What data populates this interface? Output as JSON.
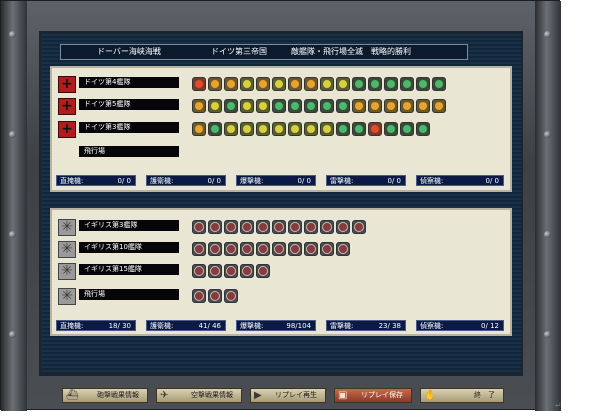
{
  "title_bar": {
    "battle": "ドーバー海峡海戦",
    "faction": "ドイツ第三帝国",
    "result": "敵艦隊・飛行場全滅　戦略的勝利"
  },
  "axis": {
    "fleets": [
      {
        "name": "ドイツ第4艦隊",
        "tokens": [
          "r",
          "o",
          "o",
          "y",
          "o",
          "y",
          "o",
          "o",
          "y",
          "y",
          "g",
          "g",
          "g",
          "g",
          "g",
          "g"
        ]
      },
      {
        "name": "ドイツ第5艦隊",
        "tokens": [
          "o",
          "y",
          "g",
          "y",
          "y",
          "g",
          "g",
          "g",
          "g",
          "g",
          "o",
          "o",
          "o",
          "o",
          "o",
          "o"
        ]
      },
      {
        "name": "ドイツ第3艦隊",
        "tokens": [
          "o",
          "g",
          "y",
          "y",
          "y",
          "y",
          "y",
          "y",
          "y",
          "g",
          "g",
          "r",
          "g",
          "g",
          "g"
        ]
      }
    ],
    "airfield_label": "飛行場",
    "stats": [
      {
        "label": "直掩機:",
        "value": "0/ 0"
      },
      {
        "label": "護衛機:",
        "value": "0/ 0"
      },
      {
        "label": "爆撃機:",
        "value": "0/ 0"
      },
      {
        "label": "雷撃機:",
        "value": "0/ 0"
      },
      {
        "label": "偵察機:",
        "value": "0/ 0"
      }
    ]
  },
  "allies": {
    "fleets": [
      {
        "name": "イギリス第3艦隊",
        "tokens": [
          "k",
          "k",
          "k",
          "k",
          "k",
          "k",
          "k",
          "k",
          "k",
          "k",
          "k"
        ]
      },
      {
        "name": "イギリス第10艦隊",
        "tokens": [
          "k",
          "k",
          "k",
          "k",
          "k",
          "k",
          "k",
          "k",
          "k",
          "k"
        ]
      },
      {
        "name": "イギリス第15艦隊",
        "tokens": [
          "k",
          "k",
          "k",
          "k",
          "k"
        ]
      }
    ],
    "airfield_label": "飛行場",
    "airfield_tokens": [
      "k",
      "k",
      "k"
    ],
    "stats": [
      {
        "label": "直掩機:",
        "value": "18/ 30"
      },
      {
        "label": "護衛機:",
        "value": "41/ 46"
      },
      {
        "label": "爆撃機:",
        "value": "98/104"
      },
      {
        "label": "雷撃機:",
        "value": "23/ 38"
      },
      {
        "label": "偵察機:",
        "value": "0/ 12"
      }
    ]
  },
  "buttons": {
    "surface": "砲撃戦果情報",
    "air": "空撃戦果情報",
    "replay_play": "リプレイ再生",
    "replay_save": "リプレイ保存",
    "end": "終　了"
  },
  "corner_mark": "↵"
}
